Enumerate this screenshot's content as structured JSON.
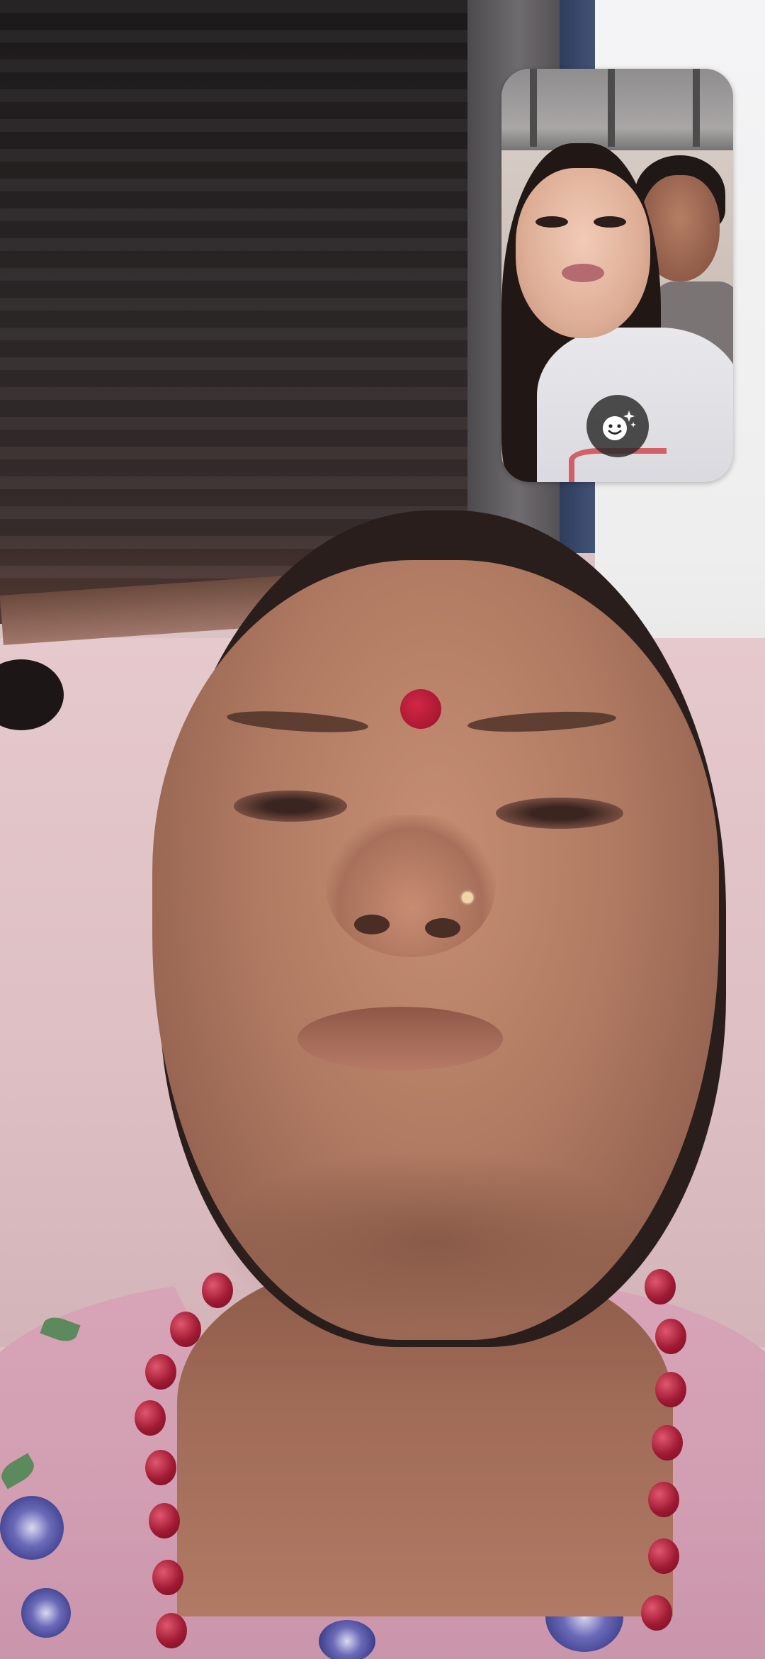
{
  "call": {
    "remote_video": {
      "label": ""
    },
    "self_view": {
      "label": ""
    },
    "effects_button": {
      "icon": "smiley-sparkle-icon",
      "label": ""
    }
  },
  "colors": {
    "pip_button_bg": "#282828",
    "icon_white": "#ffffff"
  }
}
